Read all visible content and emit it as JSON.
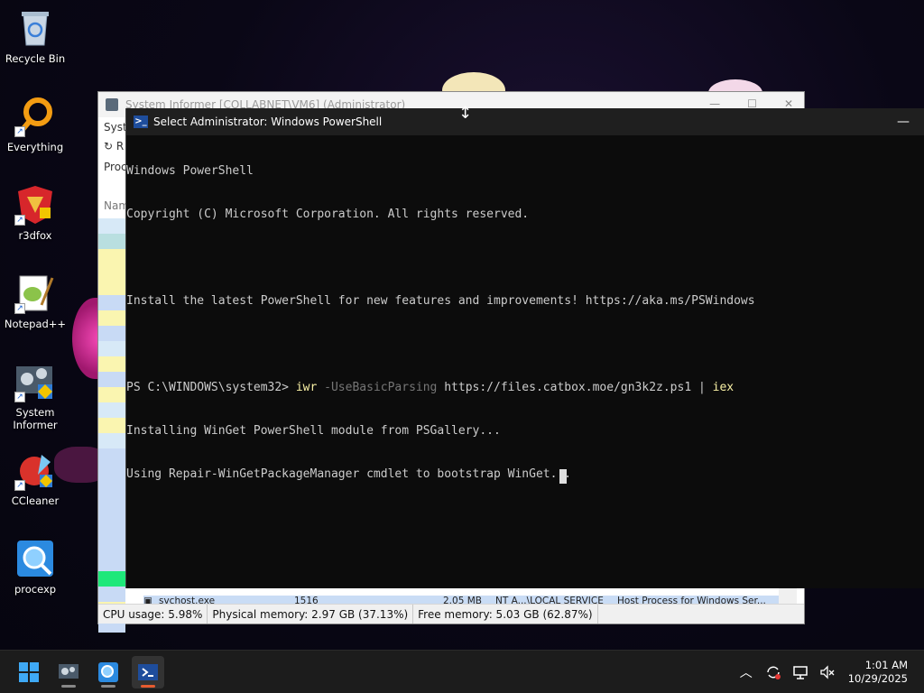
{
  "desktop": {
    "icons": [
      {
        "label": "Recycle Bin",
        "icon": "recycle-bin-icon"
      },
      {
        "label": "Everything",
        "icon": "everything-icon"
      },
      {
        "label": "r3dfox",
        "icon": "r3dfox-icon"
      },
      {
        "label": "Notepad++",
        "icon": "notepadpp-icon"
      },
      {
        "label": "System Informer",
        "icon": "system-informer-icon"
      },
      {
        "label": "CCleaner",
        "icon": "ccleaner-icon"
      },
      {
        "label": "procexp",
        "icon": "procexp-icon"
      }
    ]
  },
  "system_informer": {
    "title": "System Informer [COLLABNET\\VM6] (Administrator)",
    "menu_partial": "Syste",
    "refresh_partial": "R",
    "tab_partial": "Proc",
    "column_partial": "Nam",
    "process_row": {
      "name": "svchost.exe",
      "pid": "1516",
      "memory": "2.05 MB",
      "user": "NT A...\\LOCAL SERVICE",
      "description": "Host Process for Windows Ser..."
    },
    "status": {
      "cpu": "CPU usage: 5.98%",
      "physical": "Physical memory: 2.97 GB (37.13%)",
      "free": "Free memory: 5.03 GB (62.87%)"
    },
    "row_colors": [
      "#d7e9f7",
      "#b9dfe0",
      "#faf5b0",
      "#faf5b0",
      "#faf5b0",
      "#c8daf5",
      "#faf5b0",
      "#c8daf5",
      "#d7e9f7",
      "#faf5b0",
      "#c8daf5",
      "#faf5b0",
      "#d7e9f7",
      "#faf5b0",
      "#d7e9f7",
      "#c8daf5",
      "#c8daf5",
      "#c8daf5",
      "#c8daf5",
      "#c8daf5",
      "#c8daf5",
      "#c8daf5",
      "#c8daf5",
      "#1ee87a",
      "#c8daf5",
      "#faf5b0",
      "#c8daf5"
    ]
  },
  "powershell": {
    "title": "Select Administrator: Windows PowerShell",
    "minimize": "—",
    "lines": {
      "l1": "Windows PowerShell",
      "l2": "Copyright (C) Microsoft Corporation. All rights reserved.",
      "l3": "",
      "l4": "Install the latest PowerShell for new features and improvements! https://aka.ms/PSWindows",
      "l5": "",
      "l6_prompt": "PS C:\\WINDOWS\\system32> ",
      "l6_cmd": "iwr",
      "l6_param": " -UseBasicParsing",
      "l6_url": " https://files.catbox.moe/gn3k2z.ps1 | ",
      "l6_iex": "iex",
      "l7": "Installing WinGet PowerShell module from PSGallery...",
      "l8": "Using Repair-WinGetPackageManager cmdlet to bootstrap WinGet..."
    }
  },
  "taskbar": {
    "clock_time": "1:01 AM",
    "clock_date": "10/29/2025",
    "accent": "#e55b2f"
  }
}
